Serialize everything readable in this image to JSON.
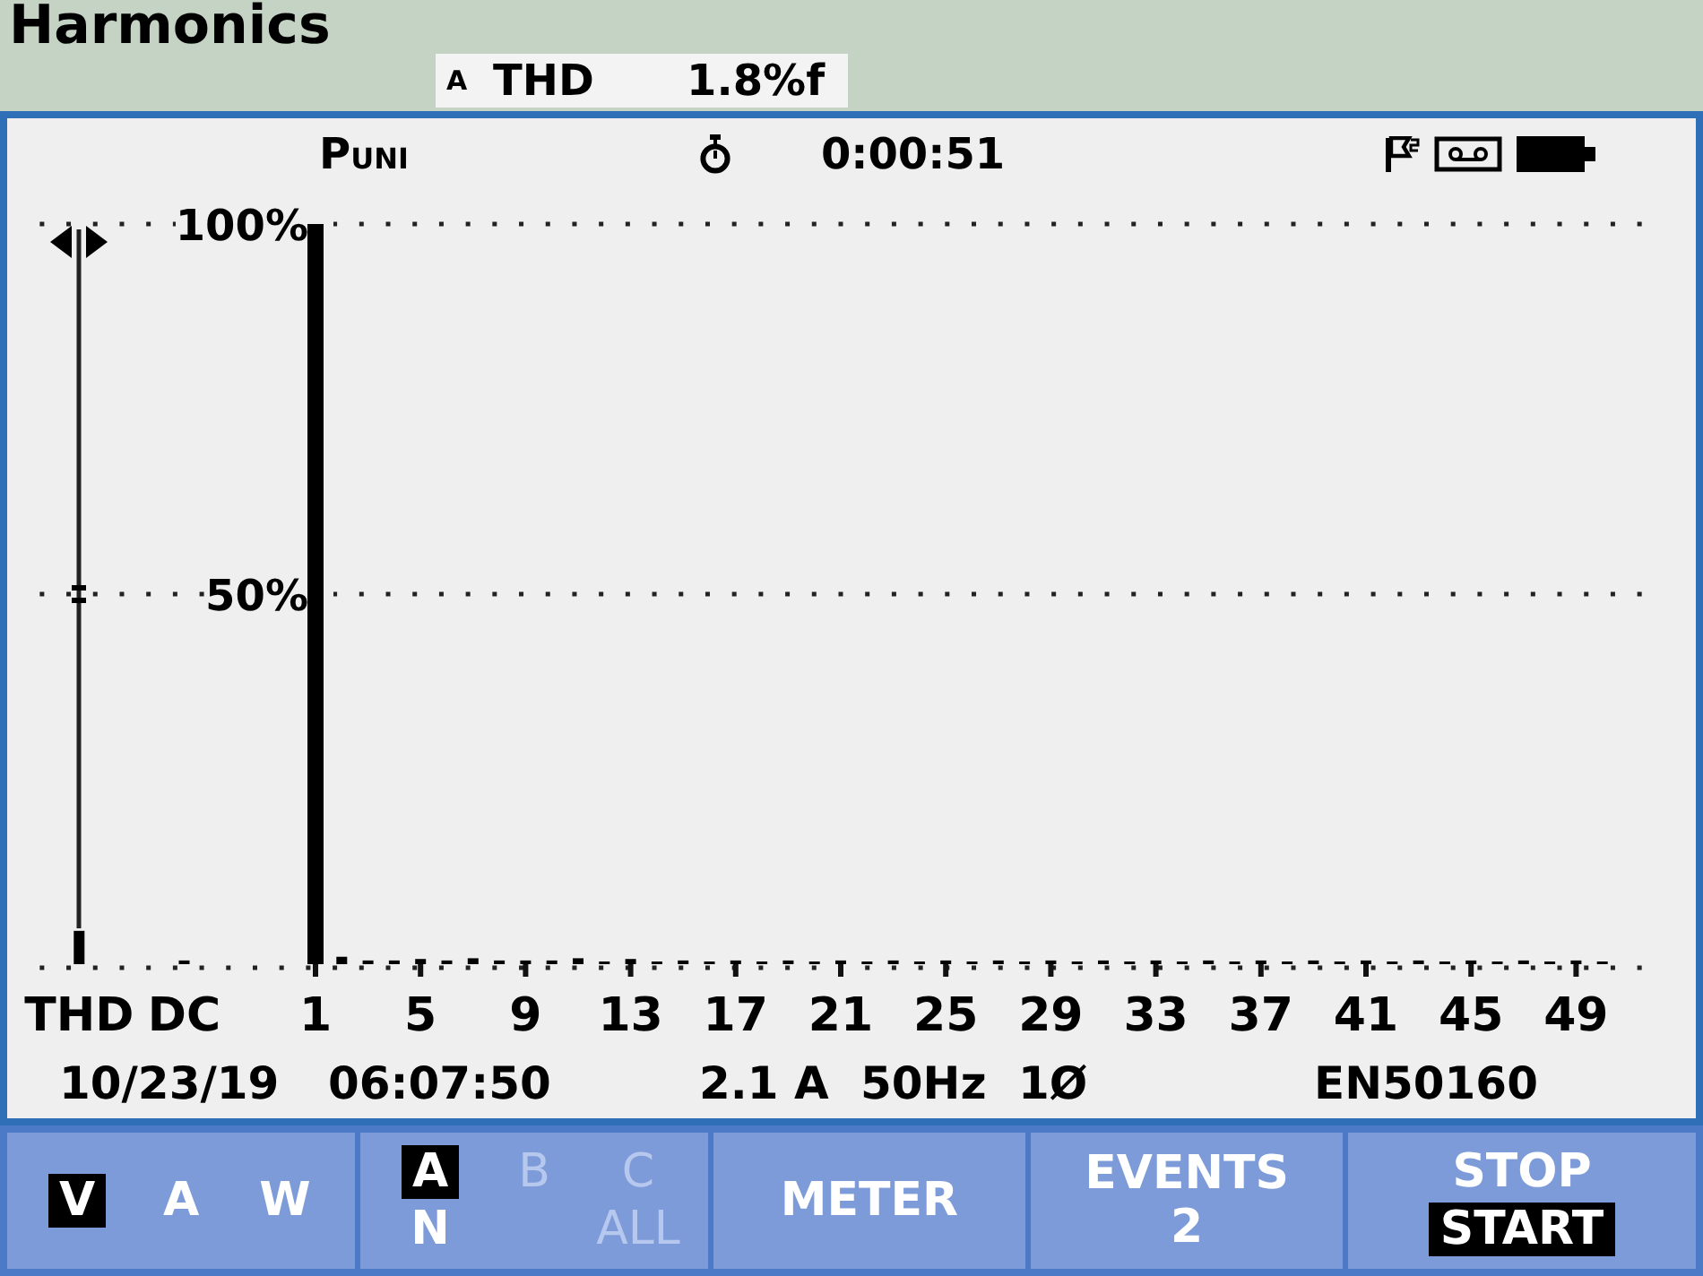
{
  "header": {
    "title": "Harmonics",
    "readout": {
      "phase": "A",
      "parameter": "THD",
      "value": "1.8%f"
    }
  },
  "panel": {
    "status": {
      "mode": "P$_{UNI}$",
      "elapsed": "0:00:51"
    },
    "chart_data": {
      "type": "bar",
      "x": [
        -8,
        -4,
        1,
        2,
        3,
        4,
        5,
        6,
        7,
        8,
        9,
        10,
        11,
        12,
        13,
        14,
        15,
        16,
        17,
        18,
        19,
        20,
        21,
        22,
        23,
        24,
        25,
        26,
        27,
        28,
        29,
        30,
        31,
        32,
        33,
        34,
        35,
        36,
        37,
        38,
        39,
        40,
        41,
        42,
        43,
        44,
        45,
        46,
        47,
        48,
        49,
        50
      ],
      "values": [
        4.5,
        0.5,
        100,
        1.0,
        0.5,
        0.5,
        0.7,
        0.5,
        0.8,
        0.5,
        0.5,
        0.5,
        0.8,
        0.3,
        0.7,
        0.3,
        0.5,
        0.3,
        0.5,
        0.3,
        0.5,
        0.3,
        0.5,
        0.3,
        0.5,
        0.3,
        0.5,
        0.3,
        0.5,
        0.3,
        0.5,
        0.3,
        0.5,
        0.3,
        0.5,
        0.3,
        0.5,
        0.3,
        0.5,
        0.3,
        0.5,
        0.3,
        0.5,
        0.3,
        0.5,
        0.3,
        0.5,
        0.3,
        0.5,
        0.3,
        0.5,
        0.3
      ],
      "xlim": [
        -9.5,
        51.5
      ],
      "ylim": [
        0,
        100
      ],
      "yticks": [
        {
          "value": 50,
          "label": "50%"
        },
        {
          "value": 100,
          "label": "100%"
        }
      ],
      "xticks": [
        {
          "value": -8,
          "label": "THD"
        },
        {
          "value": -4,
          "label": "DC"
        },
        1,
        5,
        9,
        13,
        17,
        21,
        25,
        29,
        33,
        37,
        41,
        45,
        49
      ]
    },
    "info": {
      "date": "10/23/19",
      "time": "06:07:50",
      "current": "2.1 A",
      "frequency": "50Hz",
      "phases": "1Ø",
      "standard": "EN50160"
    }
  },
  "function_keys": [
    {
      "kind": "options",
      "rows": [
        [
          {
            "label": "V",
            "selected": true,
            "disabled": false
          },
          {
            "label": "A",
            "selected": false,
            "disabled": false
          },
          {
            "label": "W",
            "selected": false,
            "disabled": false
          }
        ]
      ]
    },
    {
      "kind": "options",
      "rows": [
        [
          {
            "label": "A",
            "selected": true,
            "disabled": false
          },
          {
            "label": "B",
            "selected": false,
            "disabled": true
          },
          {
            "label": "C",
            "selected": false,
            "disabled": true
          }
        ],
        [
          {
            "label": "N",
            "selected": false,
            "disabled": false
          },
          "",
          {
            "label": "ALL",
            "selected": false,
            "disabled": true
          }
        ]
      ]
    },
    {
      "kind": "label",
      "label": "METER"
    },
    {
      "kind": "label",
      "label": "EVENTS",
      "count": "2"
    },
    {
      "kind": "options",
      "rows": [
        [
          {
            "label": "STOP",
            "selected": false,
            "disabled": false
          }
        ],
        [
          {
            "label": "START",
            "selected": true,
            "disabled": false
          }
        ]
      ]
    }
  ]
}
